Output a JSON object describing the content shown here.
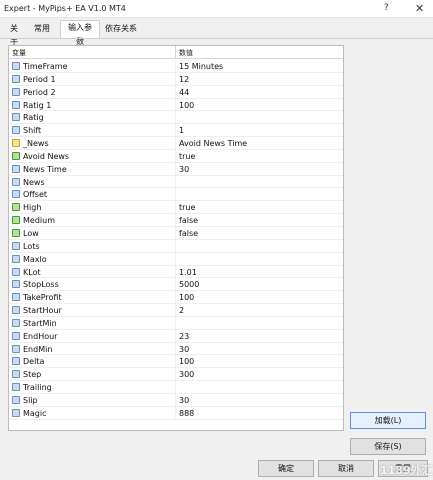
{
  "window": {
    "title": "Expert - MyPips+ EA V1.0 MT4",
    "help_label": "?",
    "close_label": "✕"
  },
  "tabs": [
    {
      "label": "关于"
    },
    {
      "label": "常用"
    },
    {
      "label": "输入参数"
    },
    {
      "label": "依存关系"
    }
  ],
  "grid": {
    "col_variable": "变量",
    "col_value": "数值"
  },
  "params": [
    {
      "name": "TimeFrame",
      "value": "15 Minutes",
      "icon": "num-icon"
    },
    {
      "name": "Period 1",
      "value": "12",
      "icon": "num-icon"
    },
    {
      "name": "Period 2",
      "value": "44",
      "icon": "num-icon"
    },
    {
      "name": "Ratig 1",
      "value": "100",
      "icon": "num-icon"
    },
    {
      "name": "Ratig",
      "value": "",
      "icon": "num-icon"
    },
    {
      "name": "Shift",
      "value": "1",
      "icon": "num-icon"
    },
    {
      "name": "_News",
      "value": "Avoid News Time",
      "icon": "ab-icon"
    },
    {
      "name": "Avoid News",
      "value": "true",
      "icon": "flag-icon"
    },
    {
      "name": "News Time",
      "value": "30",
      "icon": "num-icon"
    },
    {
      "name": "News",
      "value": "",
      "icon": "num-icon"
    },
    {
      "name": "Offset",
      "value": "",
      "icon": "num-icon"
    },
    {
      "name": "High",
      "value": "true",
      "icon": "flag-icon"
    },
    {
      "name": "Medium",
      "value": "false",
      "icon": "flag-icon"
    },
    {
      "name": "Low",
      "value": "false",
      "icon": "flag-icon"
    },
    {
      "name": "Lots",
      "value": "",
      "icon": "num-icon"
    },
    {
      "name": "Maxlo",
      "value": "",
      "icon": "num-icon"
    },
    {
      "name": "KLot",
      "value": "1.01",
      "icon": "num-icon"
    },
    {
      "name": "StopLoss",
      "value": "5000",
      "icon": "num-icon"
    },
    {
      "name": "TakeProfit",
      "value": "100",
      "icon": "num-icon"
    },
    {
      "name": "StartHour",
      "value": "2",
      "icon": "num-icon"
    },
    {
      "name": "StartMin",
      "value": "",
      "icon": "num-icon"
    },
    {
      "name": "EndHour",
      "value": "23",
      "icon": "num-icon"
    },
    {
      "name": "EndMin",
      "value": "30",
      "icon": "num-icon"
    },
    {
      "name": "Delta",
      "value": "100",
      "icon": "num-icon"
    },
    {
      "name": "Step",
      "value": "300",
      "icon": "num-icon"
    },
    {
      "name": "Trailing",
      "value": "",
      "icon": "num-icon"
    },
    {
      "name": "Slip",
      "value": "30",
      "icon": "num-icon"
    },
    {
      "name": "Magic",
      "value": "888",
      "icon": "num-icon"
    }
  ],
  "buttons": {
    "load": "加载(L)",
    "save": "保存(S)",
    "ok": "确定",
    "cancel": "取消",
    "reset": "重置"
  },
  "watermark": "1189外汇网"
}
